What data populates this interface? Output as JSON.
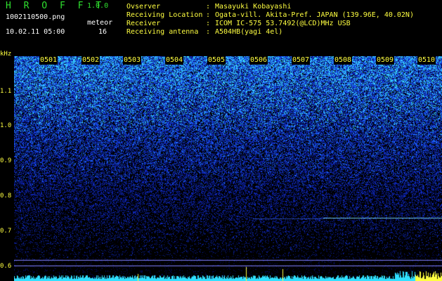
{
  "header": {
    "title": "H R O F F T",
    "version": "1.0.0",
    "filename": "1002110500.png",
    "datetime": "10.02.11 05:00",
    "meteor_label": "meteor",
    "meteor_count": "16"
  },
  "info": [
    {
      "label": "Ovserver",
      "sep": ":",
      "value": "Masayuki Kobayashi"
    },
    {
      "label": "Receiving Location",
      "sep": ":",
      "value": "Ogata-vill. Akita-Pref. JAPAN (139.96E, 40.02N)"
    },
    {
      "label": "Receiver",
      "sep": ":",
      "value": "ICOM IC-575 53.7492(@LCD)MHz USB"
    },
    {
      "label": "Receiving antenna",
      "sep": ":",
      "value": "A504HB(yagi 4el)"
    }
  ],
  "time_axis": [
    "0501",
    "0502",
    "0503",
    "0504",
    "0505",
    "0506",
    "0507",
    "0508",
    "0509",
    "0510"
  ],
  "freq_axis": {
    "unit": "kHz",
    "labels": [
      "1.1",
      "1.0",
      "0.9",
      "0.8",
      "0.7",
      "0.6"
    ]
  },
  "colors": {
    "background": "#000000",
    "header_green": "#2fe02f",
    "label_yellow": "#ffff40",
    "signal_cyan": "#30e0ff",
    "noise_blue": "#1a3cff"
  }
}
